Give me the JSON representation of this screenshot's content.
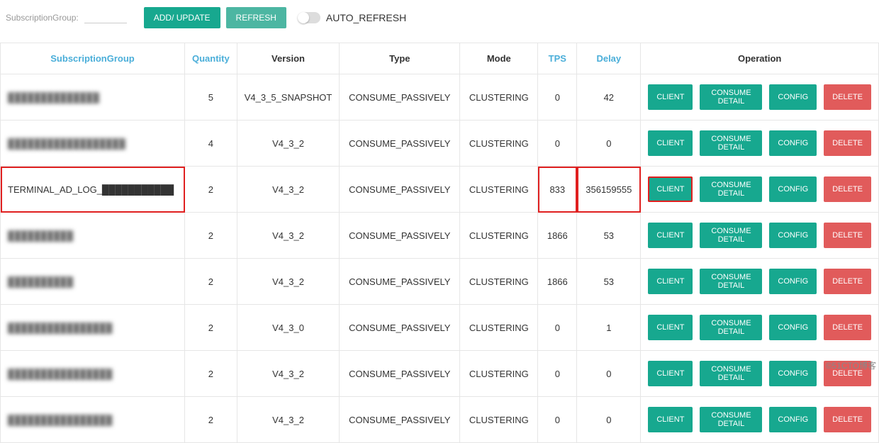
{
  "toolbar": {
    "label": "SubscriptionGroup:",
    "add_update": "ADD/ UPDATE",
    "refresh": "REFRESH",
    "auto_refresh": "AUTO_REFRESH"
  },
  "headers": {
    "subscription_group": "SubscriptionGroup",
    "quantity": "Quantity",
    "version": "Version",
    "type": "Type",
    "mode": "Mode",
    "tps": "TPS",
    "delay": "Delay",
    "operation": "Operation"
  },
  "op_labels": {
    "client": "CLIENT",
    "consume_detail": "CONSUME DETAIL",
    "config": "CONFIG",
    "delete": "DELETE"
  },
  "rows": [
    {
      "sg": "██████████████",
      "sg_blur": true,
      "qty": "5",
      "version": "V4_3_5_SNAPSHOT",
      "type": "CONSUME_PASSIVELY",
      "mode": "CLUSTERING",
      "tps": "0",
      "delay": "42",
      "highlight": false
    },
    {
      "sg": "██████████████████",
      "sg_blur": true,
      "qty": "4",
      "version": "V4_3_2",
      "type": "CONSUME_PASSIVELY",
      "mode": "CLUSTERING",
      "tps": "0",
      "delay": "0",
      "highlight": false
    },
    {
      "sg": "TERMINAL_AD_LOG_███████████",
      "sg_blur": false,
      "qty": "2",
      "version": "V4_3_2",
      "type": "CONSUME_PASSIVELY",
      "mode": "CLUSTERING",
      "tps": "833",
      "delay": "356159555",
      "highlight": true
    },
    {
      "sg": "██████████",
      "sg_blur": true,
      "qty": "2",
      "version": "V4_3_2",
      "type": "CONSUME_PASSIVELY",
      "mode": "CLUSTERING",
      "tps": "1866",
      "delay": "53",
      "highlight": false
    },
    {
      "sg": "██████████",
      "sg_blur": true,
      "qty": "2",
      "version": "V4_3_2",
      "type": "CONSUME_PASSIVELY",
      "mode": "CLUSTERING",
      "tps": "1866",
      "delay": "53",
      "highlight": false
    },
    {
      "sg": "████████████████",
      "sg_blur": true,
      "qty": "2",
      "version": "V4_3_0",
      "type": "CONSUME_PASSIVELY",
      "mode": "CLUSTERING",
      "tps": "0",
      "delay": "1",
      "highlight": false
    },
    {
      "sg": "████████████████",
      "sg_blur": true,
      "qty": "2",
      "version": "V4_3_2",
      "type": "CONSUME_PASSIVELY",
      "mode": "CLUSTERING",
      "tps": "0",
      "delay": "0",
      "highlight": false
    },
    {
      "sg": "████████████████",
      "sg_blur": true,
      "qty": "2",
      "version": "V4_3_2",
      "type": "CONSUME_PASSIVELY",
      "mode": "CLUSTERING",
      "tps": "0",
      "delay": "0",
      "highlight": false
    }
  ],
  "watermark": "©51CTO博客"
}
